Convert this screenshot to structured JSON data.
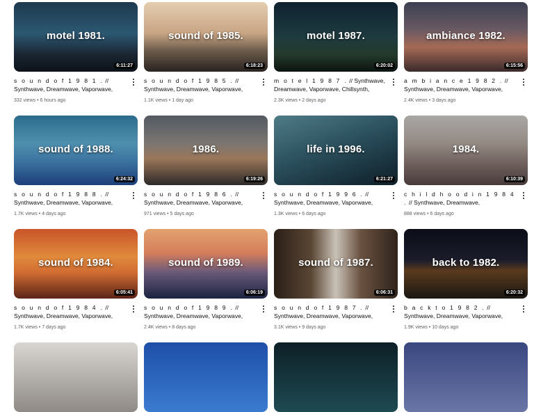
{
  "videos": [
    {
      "title_spaced": "s o u n d o f 1 9 8 1 .",
      "title_rest": " // Synthwave, Dreamwave, Vaporwave, Chillsynth, Study,...",
      "thumb_text": "motel 1981.",
      "duration": "6:11:27",
      "views": "332 views",
      "age": "6 hours ago",
      "bg": "linear-gradient(180deg,#1d3a4f 0%,#2c5872 45%,#1a2633 75%,#0c1218 100%)"
    },
    {
      "title_spaced": "s o u n d o f 1 9 8 5 .",
      "title_rest": " // Synthwave, Dreamwave, Vaporwave, Chillsynth, Study,...",
      "thumb_text": "sound of 1985.",
      "duration": "6:18:23",
      "views": "1.1K views",
      "age": "1 day ago",
      "bg": "linear-gradient(180deg,#e4cdb1 0%,#c8a584 45%,#6b5a4a 70%,#2a2320 100%)"
    },
    {
      "title_spaced": "m o t e l 1 9 8 7 .",
      "title_rest": " // Synthwave, Dreamwave, Vaporwave, Chillsynth, Study,...",
      "thumb_text": "motel 1987.",
      "duration": "6:20:02",
      "views": "2.3K views",
      "age": "2 days ago",
      "bg": "linear-gradient(180deg,#0f2230 0%,#1e3b3f 50%,#243a2c 75%,#0c1410 100%)"
    },
    {
      "title_spaced": "a m b i a n c e 1 9 8 2 .",
      "title_rest": " // Synthwave, Dreamwave, Vaporwave, Chillsynth, Study,...",
      "thumb_text": "ambiance 1982.",
      "duration": "6:15:56",
      "views": "2.4K views",
      "age": "3 days ago",
      "bg": "linear-gradient(180deg,#3c4052 0%,#6a5a63 40%,#a66a55 65%,#3a2a2c 100%)"
    },
    {
      "title_spaced": "s o u n d o f 1 9 8 8 .",
      "title_rest": " // Synthwave, Dreamwave, Vaporwave, Chillsynth, Study,...",
      "thumb_text": "sound of 1988.",
      "duration": "6:24:32",
      "views": "1.7K views",
      "age": "4 days ago",
      "bg": "linear-gradient(180deg,#2b6c8c 0%,#4f8fae 40%,#3c74a0 65%,#1d3f7a 100%)"
    },
    {
      "title_spaced": "s o u n d o f 1 9 8 6 .",
      "title_rest": " // Synthwave, Dreamwave, Vaporwave, Chillsynth, Study,...",
      "thumb_text": "1986.",
      "duration": "6:19:26",
      "views": "971 views",
      "age": "5 days ago",
      "bg": "linear-gradient(180deg,#545a62 0%,#7b7672 40%,#9a7659 62%,#2d2a29 100%)"
    },
    {
      "title_spaced": "s o u n d o f 1 9 9 6 .",
      "title_rest": " // Synthwave, Dreamwave, Vaporwave, Chillsynth, Study,...",
      "thumb_text": "life in 1996.",
      "duration": "6:21:27",
      "views": "1.3K views",
      "age": "6 days ago",
      "bg": "linear-gradient(160deg,#4f7c86 0%,#2f5563 40%,#1d3945 70%,#0f1f28 100%)"
    },
    {
      "title_spaced": "c h i l d h o o d i n 1 9 8 4 .",
      "title_rest": " // Synthwave, Dreamwave, Vaporwave,...",
      "thumb_text": "1984.",
      "duration": "6:10:39",
      "views": "888 views",
      "age": "6 days ago",
      "bg": "linear-gradient(180deg,#a9a7a4 0%,#948a84 40%,#6e5f5c 70%,#473b3a 100%)"
    },
    {
      "title_spaced": "s o u n d o f 1 9 8 4 .",
      "title_rest": " // Synthwave, Dreamwave, Vaporwave, Chillsynth, Study,...",
      "thumb_text": "sound of 1984.",
      "duration": "6:05:41",
      "views": "1.7K views",
      "age": "7 days ago",
      "bg": "linear-gradient(180deg,#c9542a 0%,#e08a3c 40%,#d26d33 62%,#5a2416 100%)"
    },
    {
      "title_spaced": "s o u n d o f 1 9 8 9 .",
      "title_rest": " // Synthwave, Dreamwave, Vaporwave, Chillsynth, Study,...",
      "thumb_text": "sound of 1989.",
      "duration": "6:06:19",
      "views": "2.4K views",
      "age": "8 days ago",
      "bg": "linear-gradient(180deg,#e3a26e 0%,#d47d5c 35%,#6b5a7a 62%,#1a2340 100%)"
    },
    {
      "title_spaced": "s o u n d o f 1 9 8 7 .",
      "title_rest": " // Synthwave, Dreamwave, Vaporwave, Chillsynth, Study,...",
      "thumb_text": "sound of 1987.",
      "duration": "6:06:31",
      "views": "3.1K views",
      "age": "9 days ago",
      "bg": "linear-gradient(90deg,#2a1f17 0%,#5a4634 30%,#c9c1b6 50%,#6a5241 70%,#2f231a 100%)"
    },
    {
      "title_spaced": "b a c k t o 1 9 8 2 .",
      "title_rest": " // Synthwave, Dreamwave, Vaporwave, Chillsynth",
      "thumb_text": "back to 1982.",
      "duration": "6:20:32",
      "views": "1.9K views",
      "age": "10 days ago",
      "bg": "linear-gradient(180deg,#0b0d18 0%,#1b1c2a 45%,#5a3a1e 60%,#1a1712 100%)"
    }
  ],
  "partial_row": [
    {
      "bg": "linear-gradient(180deg,#d9d6d2 0%,#8f8a86 100%)"
    },
    {
      "bg": "linear-gradient(180deg,#1e4fa8 0%,#3a7bd0 100%)"
    },
    {
      "bg": "linear-gradient(180deg,#0d1f26 0%,#1e4a52 100%)"
    },
    {
      "bg": "linear-gradient(180deg,#3a4780 0%,#6a76a6 100%)"
    }
  ]
}
